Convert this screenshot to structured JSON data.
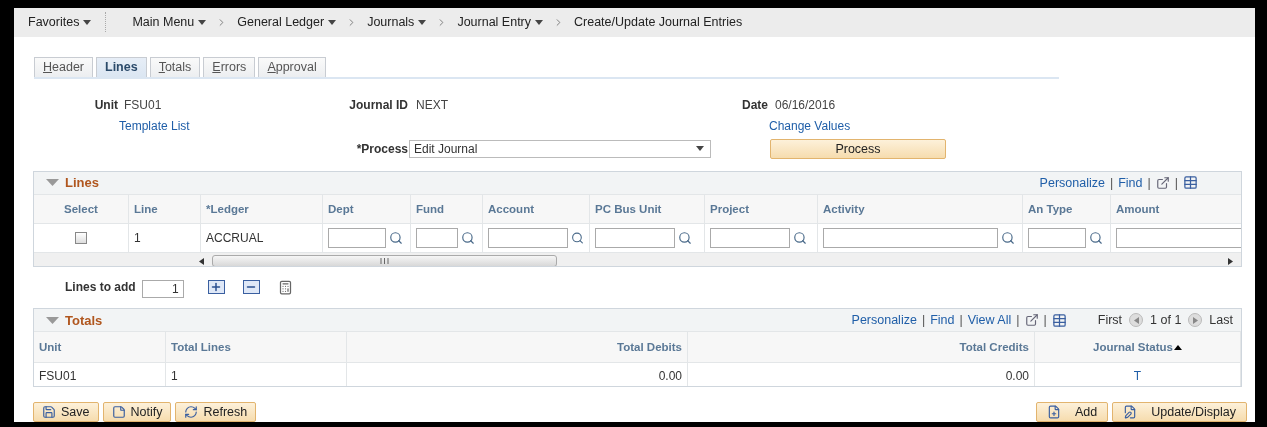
{
  "breadcrumb": [
    {
      "label": "Favorites",
      "menu": true
    },
    {
      "label": "Main Menu",
      "menu": true
    },
    {
      "label": "General Ledger",
      "menu": true
    },
    {
      "label": "Journals",
      "menu": true
    },
    {
      "label": "Journal Entry",
      "menu": true
    },
    {
      "label": "Create/Update Journal Entries",
      "menu": false
    }
  ],
  "tabs": [
    {
      "label": "Header",
      "selected": false
    },
    {
      "label": "Lines",
      "selected": true
    },
    {
      "label": "Totals",
      "selected": false
    },
    {
      "label": "Errors",
      "selected": false
    },
    {
      "label": "Approval",
      "selected": false
    }
  ],
  "header": {
    "unit_label": "Unit",
    "unit": "FSU01",
    "template_link": "Template List",
    "journal_id_label": "Journal ID",
    "journal_id": "NEXT",
    "date_label": "Date",
    "date": "06/16/2016",
    "change_link": "Change Values",
    "process_label": "*Process",
    "process_value": "Edit Journal",
    "process_button": "Process"
  },
  "lines_grid": {
    "title": "Lines",
    "tools": [
      {
        "kind": "link",
        "text": "Personalize"
      },
      {
        "kind": "separator",
        "text": "|"
      },
      {
        "kind": "link",
        "text": "Find"
      },
      {
        "kind": "separator",
        "text": "|"
      },
      {
        "kind": "new_window"
      },
      {
        "kind": "separator",
        "text": "|"
      },
      {
        "kind": "export"
      }
    ],
    "columns": [
      {
        "label": "Select",
        "kind": "checkbox"
      },
      {
        "label": "Line",
        "kind": "text"
      },
      {
        "label": "*Ledger",
        "kind": "text"
      },
      {
        "label": "Dept",
        "kind": "lookup"
      },
      {
        "label": "Fund",
        "kind": "lookup"
      },
      {
        "label": "Account",
        "kind": "lookup"
      },
      {
        "label": "PC Bus Unit",
        "kind": "lookup"
      },
      {
        "label": "Project",
        "kind": "lookup"
      },
      {
        "label": "Activity",
        "kind": "lookup"
      },
      {
        "label": "An Type",
        "kind": "lookup"
      },
      {
        "label": "Amount",
        "kind": "input"
      }
    ],
    "rows": [
      {
        "checked": false,
        "values": [
          "1",
          "ACCRUAL"
        ]
      }
    ]
  },
  "lines_to_add": {
    "label": "Lines to add",
    "value": "1"
  },
  "totals_grid": {
    "title": "Totals",
    "tools": [
      {
        "kind": "link",
        "text": "Personalize"
      },
      {
        "kind": "separator",
        "text": "|"
      },
      {
        "kind": "link",
        "text": "Find"
      },
      {
        "kind": "separator",
        "text": "|"
      },
      {
        "kind": "link",
        "text": "View All"
      },
      {
        "kind": "separator",
        "text": "|"
      },
      {
        "kind": "new_window"
      },
      {
        "kind": "separator",
        "text": "|"
      },
      {
        "kind": "export"
      }
    ],
    "pager": {
      "first": "First",
      "range": "1 of 1",
      "last": "Last"
    },
    "columns": [
      {
        "label": "Unit",
        "sorted": false
      },
      {
        "label": "Total Lines",
        "sorted": false
      },
      {
        "label": "Total Debits",
        "sorted": false
      },
      {
        "label": "Total Credits",
        "sorted": false
      },
      {
        "label": "Journal Status",
        "sorted": true
      }
    ],
    "rows": [
      {
        "cells": [
          "FSU01",
          "1",
          "0.00",
          "0.00",
          "T"
        ]
      }
    ]
  },
  "buttons_left": [
    {
      "label": "Save"
    },
    {
      "label": "Notify"
    },
    {
      "label": "Refresh"
    }
  ],
  "buttons_right": [
    {
      "label": "Add"
    },
    {
      "label": "Update/Display"
    }
  ]
}
